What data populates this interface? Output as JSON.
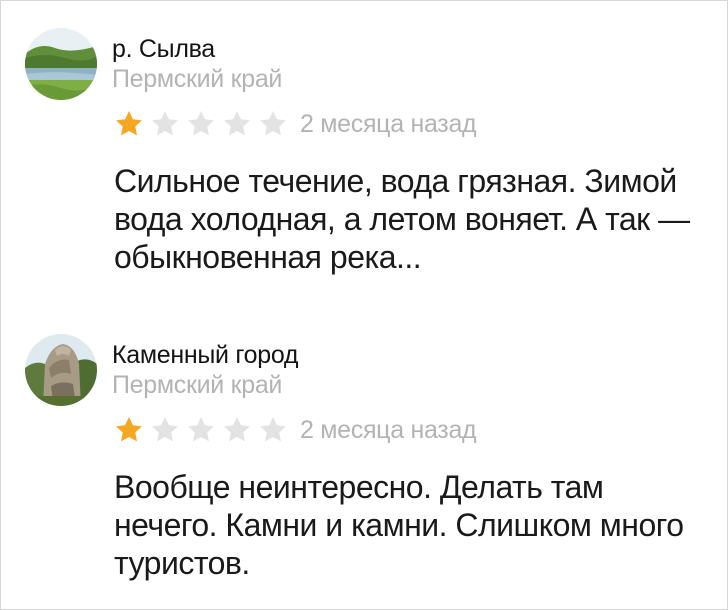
{
  "reviews": [
    {
      "place_name": "р. Сылва",
      "region": "Пермский край",
      "rating": 1,
      "rating_max": 5,
      "date": "2 месяца назад",
      "text": "Сильное течение, вода грязная. Зимой вода холодная, а летом воняет. А так — обыкновенная река..."
    },
    {
      "place_name": "Каменный город",
      "region": "Пермский край",
      "rating": 1,
      "rating_max": 5,
      "date": "2 месяца назад",
      "text": "Вообще неинтересно. Делать там нечего. Камни и камни. Слишком много туристов."
    }
  ],
  "colors": {
    "star_filled": "#f5a623",
    "star_empty": "#e3e3e3",
    "muted_text": "#b3b3b3"
  }
}
